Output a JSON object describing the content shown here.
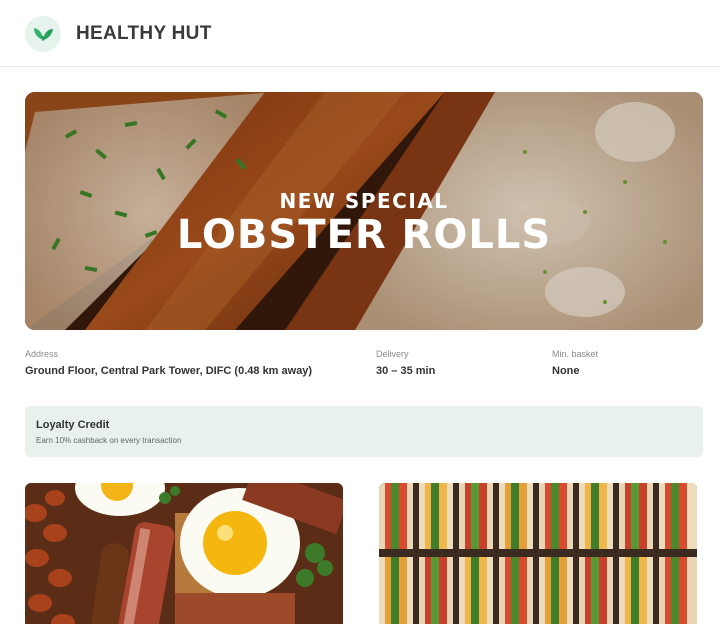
{
  "header": {
    "brand": "HEALTHY HUT",
    "logo_icon": "leaf-icon",
    "accent": "#2fb36b"
  },
  "hero": {
    "subtitle": "NEW SPECIAL",
    "title": "LOBSTER ROLLS"
  },
  "info": {
    "address": {
      "label": "Address",
      "value": "Ground Floor, Central Park Tower, DIFC (0.48 km away)"
    },
    "delivery": {
      "label": "Delivery",
      "value": "30 – 35 min"
    },
    "min_basket": {
      "label": "Min. basket",
      "value": "None"
    }
  },
  "loyalty": {
    "title": "Loyalty Credit",
    "description": "Earn 10% cashback on every transaction",
    "background": "#e8f1ec"
  },
  "menu_cards": [
    {
      "name": "breakfast-card"
    },
    {
      "name": "sandwiches-card"
    }
  ]
}
